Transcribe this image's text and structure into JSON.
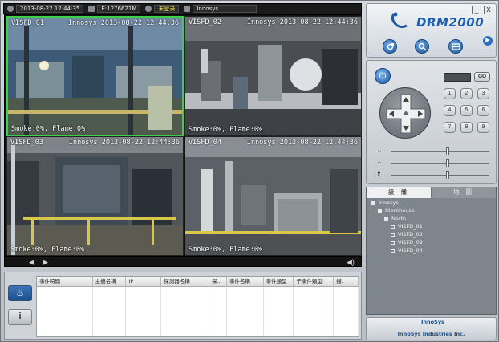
{
  "status_bar": {
    "datetime": "2013-08-22 12:44:35",
    "disk": "E:1276621M",
    "user": "未登录",
    "site": "Innosys"
  },
  "cameras": [
    {
      "name": "VISFD_01",
      "timestamp": "Innosys 2013-08-22 12:44:36",
      "sensor": "Smoke:0%, Flame:0%",
      "selected": true
    },
    {
      "name": "VISFD_02",
      "timestamp": "Innosys 2013-08-22 12:44:36",
      "sensor": "Smoke:0%, Flame:0%",
      "selected": false
    },
    {
      "name": "VISFD_03",
      "timestamp": "Innosys 2013-08-22 12:44:36",
      "sensor": "Smoke:0%, Flame:0%",
      "selected": false
    },
    {
      "name": "VISFD_04",
      "timestamp": "Innosys 2013-08-22 12:44:36",
      "sensor": "Smoke:0%, Flame:0%",
      "selected": false
    }
  ],
  "video_footer": {
    "prev_icon": "arrow-left-icon",
    "next_icon": "arrow-right-icon",
    "volume_icon": "speaker-icon"
  },
  "events": {
    "columns": [
      "事件時間",
      "主機名稱",
      "IP",
      "探測器名稱",
      "探...",
      "事件名稱",
      "事件類型",
      "子事件類型",
      "描."
    ],
    "side_buttons": [
      "fire-icon",
      "info-icon"
    ]
  },
  "header": {
    "logo": "DRM2000",
    "window_controls": [
      "_",
      "X"
    ],
    "tool_buttons": [
      "camera-icon",
      "search-icon",
      "grid-icon"
    ],
    "play_icon": "play-icon"
  },
  "ptz": {
    "go_label": "GO",
    "numpad": [
      "1",
      "2",
      "3",
      "4",
      "5",
      "6",
      "7",
      "8",
      "9"
    ],
    "sliders": [
      {
        "icon": "zoom-icon",
        "level": 0.58
      },
      {
        "icon": "focus-icon",
        "level": 0.58
      },
      {
        "icon": "iris-icon",
        "level": 0.58
      }
    ]
  },
  "tree_panel": {
    "tabs": [
      "設 備",
      "地 圖"
    ],
    "items": [
      {
        "label": "Innosys",
        "depth": 0,
        "type": "expanded"
      },
      {
        "label": "Storehouse",
        "depth": 1,
        "type": "expanded"
      },
      {
        "label": "North",
        "depth": 2,
        "type": "expanded"
      },
      {
        "label": "VISFD_01",
        "depth": 3,
        "type": "leaf"
      },
      {
        "label": "VISFD_02",
        "depth": 3,
        "type": "leaf"
      },
      {
        "label": "VISFD_03",
        "depth": 3,
        "type": "leaf"
      },
      {
        "label": "VISFD_04",
        "depth": 3,
        "type": "leaf"
      }
    ]
  },
  "brand": {
    "logo": "InnoSys",
    "name": "InnoSys Industries Inc."
  }
}
